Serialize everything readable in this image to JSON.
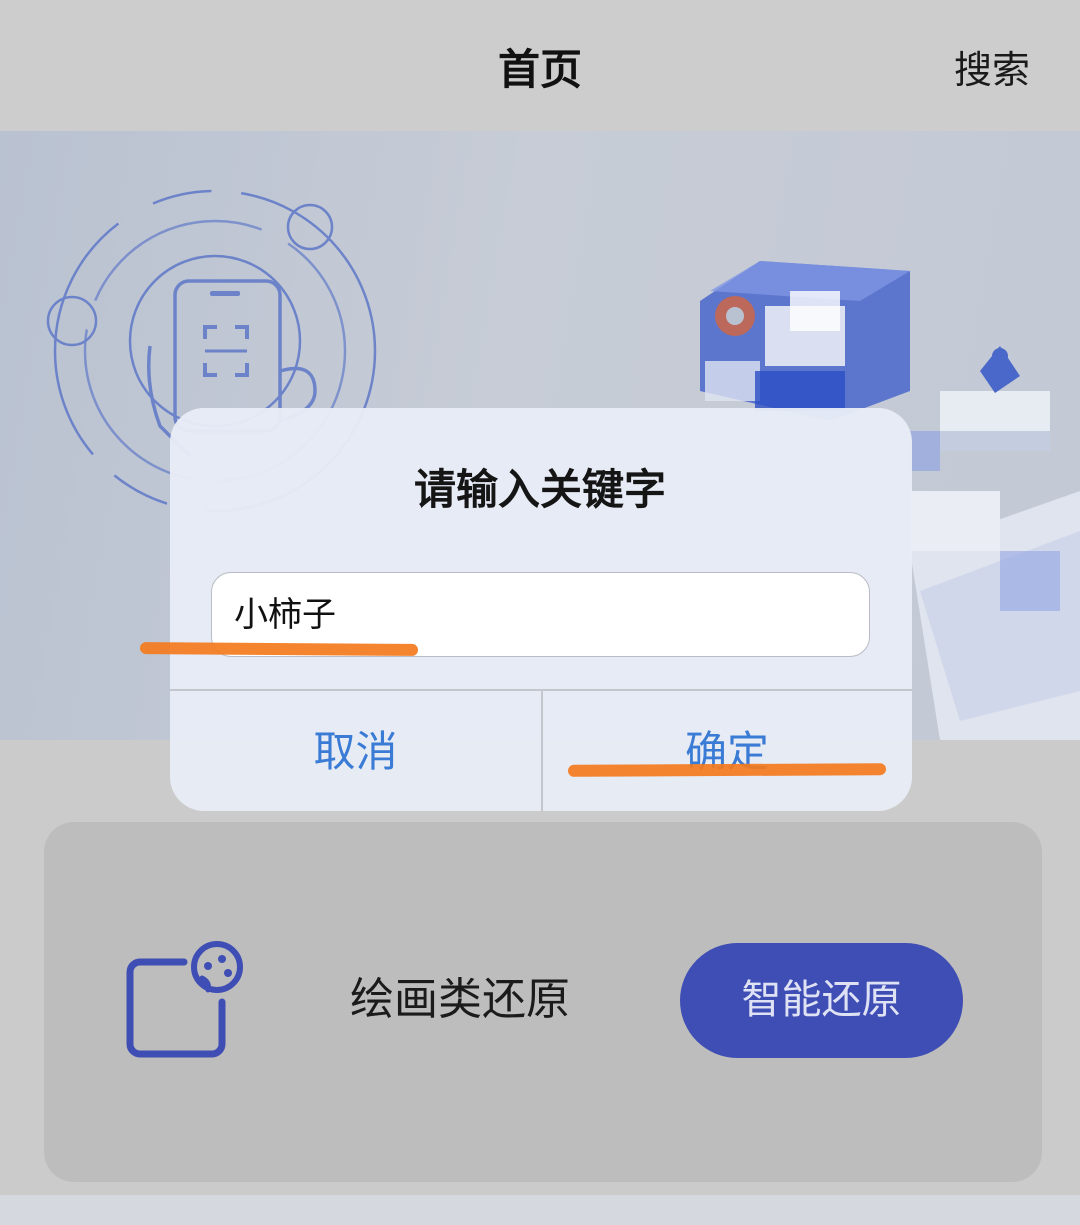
{
  "header": {
    "title": "首页",
    "search_label": "搜索"
  },
  "dialog": {
    "title": "请输入关键字",
    "input_value": "小柿子",
    "cancel_label": "取消",
    "confirm_label": "确定"
  },
  "card": {
    "label": "绘画类还原",
    "button_label": "智能还原",
    "icon": "palette-icon"
  },
  "colors": {
    "accent": "#3f4eb4",
    "dialog_button": "#3a7bd5",
    "highlight": "#f47a1c"
  }
}
